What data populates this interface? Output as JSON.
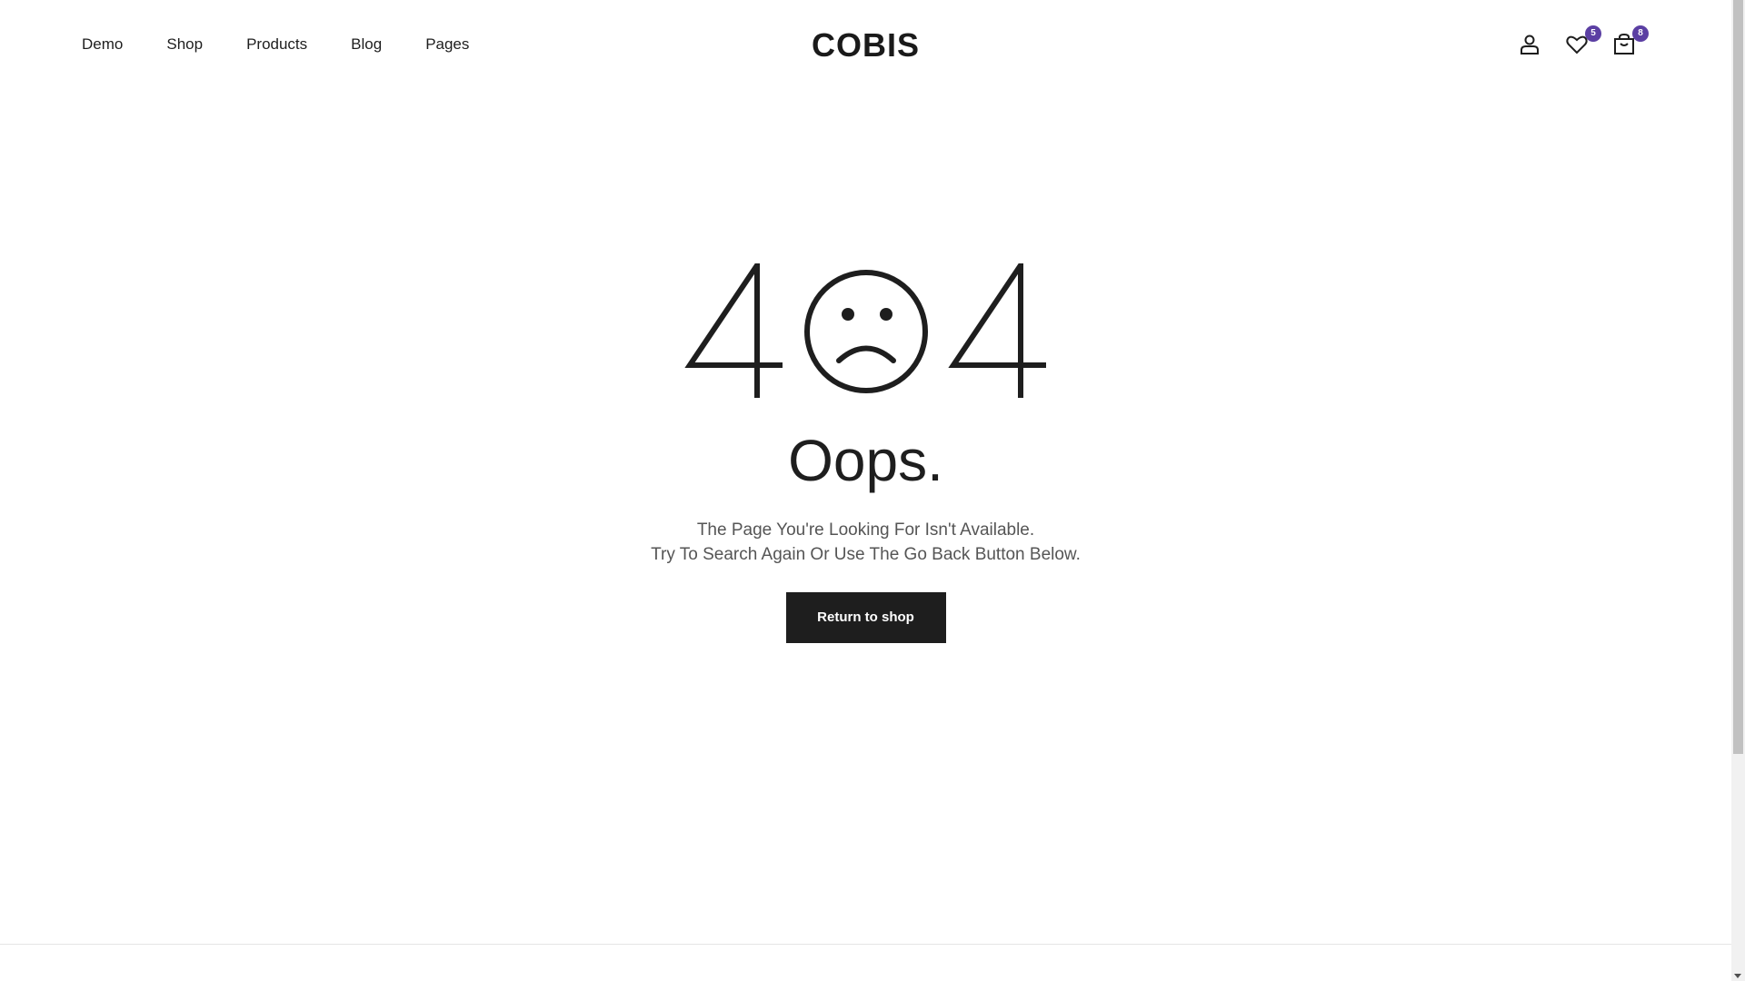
{
  "header": {
    "nav": [
      {
        "label": "Demo"
      },
      {
        "label": "Shop"
      },
      {
        "label": "Products"
      },
      {
        "label": "Blog"
      },
      {
        "label": "Pages"
      }
    ],
    "logo": "COBIS",
    "icons": {
      "account": "user-icon",
      "wishlist": "heart-icon",
      "cart": "cart-icon"
    },
    "wishlist_count": "5",
    "cart_count": "8",
    "badge_color": "#5b3fa3"
  },
  "error": {
    "code_first": "4",
    "code_face": "sad-face-icon",
    "code_last": "4",
    "heading": "Oops.",
    "message_line1": "The Page You're Looking For Isn't Available.",
    "message_line2": "Try To Search Again Or Use The Go Back Button Below.",
    "button_label": "Return to shop"
  },
  "colors": {
    "text": "#1e1e1e",
    "muted": "#555555",
    "button_bg": "#1e1e1e",
    "button_text": "#ffffff"
  }
}
